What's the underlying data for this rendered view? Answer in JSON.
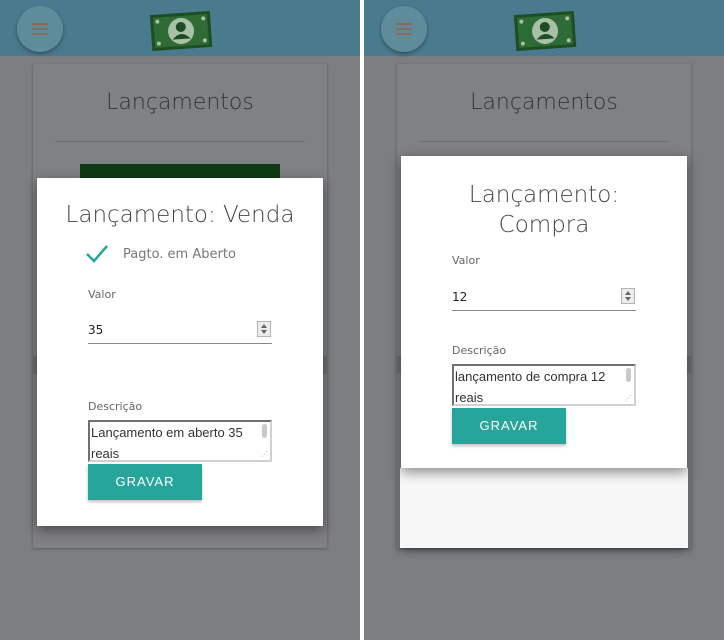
{
  "colors": {
    "topbar": "#4a7a8e",
    "accent_teal": "#26a69a",
    "overlay": "#7d7e82"
  },
  "icons": {
    "menu": "hamburger-menu-icon",
    "logo": "money-bill-icon",
    "check": "checkmark-icon"
  },
  "left": {
    "background_title": "Lançamentos",
    "modal": {
      "title": "Lançamento: Venda",
      "checkbox_label": "Pagto. em Aberto",
      "checkbox_checked": true,
      "valor_label": "Valor",
      "valor_value": "35",
      "descricao_label": "Descrição",
      "descricao_line1": "Lançamento em aberto 35",
      "descricao_line2": "reais",
      "button_label": "GRAVAR"
    }
  },
  "right": {
    "background_title": "Lançamentos",
    "modal": {
      "title_line1": "Lançamento:",
      "title_line2": "Compra",
      "valor_label": "Valor",
      "valor_value": "12",
      "descricao_label": "Descrição",
      "descricao_line1": "lançamento de compra 12",
      "descricao_line2": "reais",
      "button_label": "GRAVAR"
    }
  }
}
